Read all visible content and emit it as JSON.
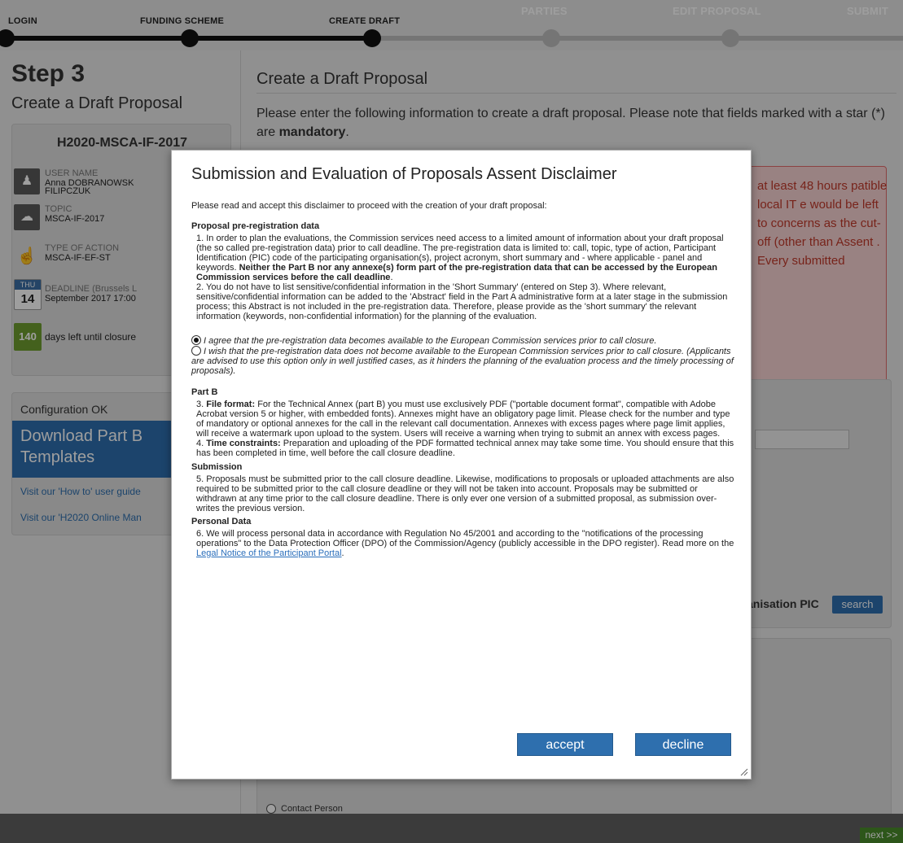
{
  "wizard": {
    "steps": [
      {
        "label": "LOGIN",
        "state": "done"
      },
      {
        "label": "FUNDING SCHEME",
        "state": "done"
      },
      {
        "label": "CREATE DRAFT",
        "state": "current"
      },
      {
        "label": "PARTIES",
        "state": "todo"
      },
      {
        "label": "EDIT PROPOSAL",
        "state": "todo"
      },
      {
        "label": "SUBMIT",
        "state": "todo"
      }
    ]
  },
  "sidebar": {
    "step_title": "Step 3",
    "step_subtitle": "Create a Draft Proposal",
    "call_id": "H2020-MSCA-IF-2017",
    "username_key": "USER NAME",
    "username_val1": "Anna DOBRANOWSK",
    "username_val2": "FILIPCZUK",
    "topic_key": "TOPIC",
    "topic_val": "MSCA-IF-2017",
    "action_key": "TYPE OF ACTION",
    "action_val": "MSCA-IF-EF-ST",
    "deadline_dow": "THU",
    "deadline_day": "14",
    "deadline_key": "DEADLINE (Brussels L",
    "deadline_val": "September 2017 17:00",
    "days_left": "140",
    "days_left_text": "days left until closure",
    "config_status": "Configuration OK",
    "download_label": "Download Part B Templates",
    "link_howto": "Visit our 'How to' user guide",
    "link_manual": "Visit our 'H2020 Online Man"
  },
  "main": {
    "title": "Create a Draft Proposal",
    "intro_pre": "Please enter the following information to create a draft proposal. Please note that fields marked with a star (*) are ",
    "intro_bold": "mandatory",
    "intro_post": ".",
    "warning_text": "at least 48 hours patible local IT e would be left to concerns as the cut-off (other than Assent . Every submitted",
    "pic_label": "anisation PIC",
    "search_label": "search",
    "contact_radio": "Contact Person",
    "next_label": "next >>"
  },
  "modal": {
    "title": "Submission and Evaluation of Proposals Assent Disclaimer",
    "intro": "Please read and accept this disclaimer to proceed with the creation of your draft proposal:",
    "h_prereg": "Proposal pre-registration data",
    "p1_a": "1.   In order to plan the evaluations, the Commission services need access to a limited amount of information about your draft proposal (the so called pre-registration data) prior to call deadline. The pre-registration data is limited to: call, topic, type of action, Participant Identification (PIC) code of the participating organisation(s), project acronym, short summary and - where applicable - panel and keywords. ",
    "p1_b": "Neither the Part B nor any annexe(s) form part of the pre-registration data that can be accessed by the European Commission services before the call deadline",
    "p1_c": ".",
    "p2": "2.   You do not have to list sensitive/confidential information in the 'Short Summary' (entered on Step 3). Where relevant, sensitive/confidential information can be added to the 'Abstract' field in the Part A administrative form at a later stage in the submission process; this Abstract is not included in the pre-registration data. Therefore, please provide as the 'short summary' the relevant information (keywords, non-confidential information) for the planning of the evaluation.",
    "radio_agree": "I agree that the pre-registration data becomes available to the European Commission services prior to call closure.",
    "radio_disagree": "I wish that the pre-registration data does not become available to the European Commission services prior to call closure. (Applicants are advised to use this option only in well justified cases, as it hinders the planning of the evaluation process and the timely processing of proposals).",
    "h_partb": "Part B",
    "p3_lead": "3.   ",
    "p3_bold": "File format:",
    "p3": " For the Technical Annex (part B) you must use exclusively PDF (\"portable document format\", compatible with Adobe Acrobat version 5 or higher, with embedded fonts). Annexes might have an obligatory page limit. Please check for the number and type of mandatory or optional annexes for the call in the relevant call documentation. Annexes with excess pages where page limit applies, will receive a watermark upon upload to the system. Users will receive a warning when trying to submit an annex with excess pages.",
    "p4_lead": "4.   ",
    "p4_bold": "Time constraints:",
    "p4": " Preparation and uploading of the PDF formatted technical annex may take some time. You should ensure that this has been completed in time, well before the call closure deadline.",
    "h_submission": "Submission",
    "p5": "5.   Proposals must be submitted prior to the call closure deadline. Likewise, modifications to proposals or uploaded attachments are also required to be submitted prior to the call closure deadline or they will not be taken into account. Proposals may be submitted or withdrawn at any time prior to the call closure deadline. There is only ever one version of a submitted proposal, as submission over-writes the previous version.",
    "h_personal": "Personal Data",
    "p6": "6.   We will process personal data in accordance with Regulation No 45/2001 and according to the \"notifications of the processing operations\" to the Data Protection Officer (DPO) of the Commission/Agency (publicly accessible in the DPO register). Read more on the ",
    "p6_link": "Legal Notice of the Participant Portal",
    "p6_end": ".",
    "accept_label": "accept",
    "decline_label": "decline"
  }
}
